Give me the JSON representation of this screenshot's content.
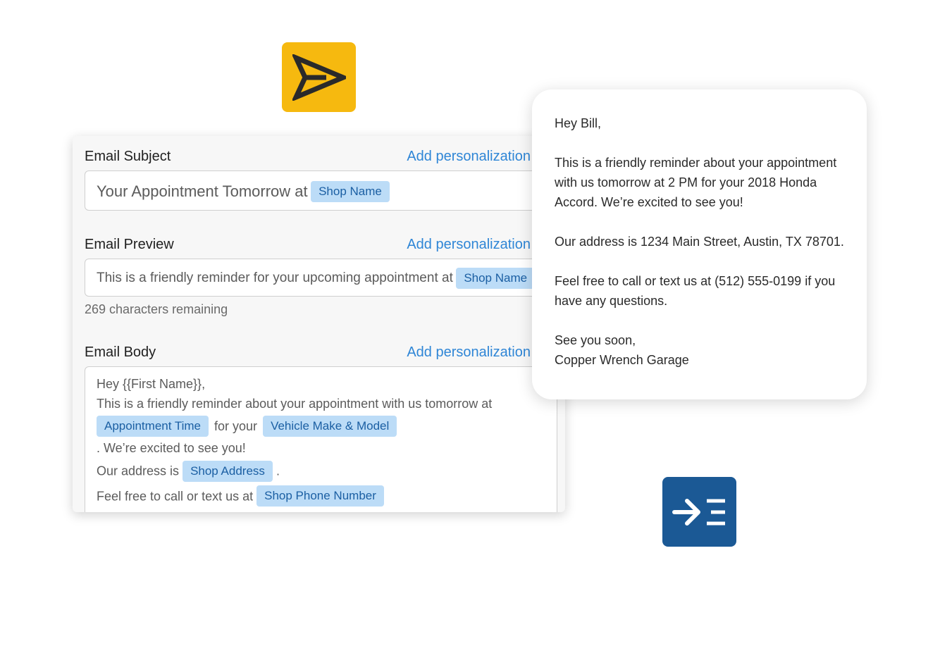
{
  "icons": {
    "send": "send-arrow-icon",
    "indent": "indent-arrow-icon",
    "send_color": "#f6b90f",
    "indent_color": "#1b5995"
  },
  "editor": {
    "subject": {
      "label": "Email Subject",
      "add_link": "Add personalization",
      "text": "Your Appointment Tomorrow at",
      "chip": "Shop Name"
    },
    "preview": {
      "label": "Email Preview",
      "add_link": "Add personalization",
      "text": "This is a friendly reminder for your upcoming appointment at",
      "chip": "Shop Name",
      "remaining": "269 characters remaining"
    },
    "body": {
      "label": "Email Body",
      "add_link": "Add personalization",
      "line1": "Hey {{First Name}},",
      "line2": "This is a friendly reminder about your appointment with us tomorrow at",
      "chip_time": "Appointment Time",
      "text_for": "for your",
      "chip_vehicle": "Vehicle Make & Model",
      "line4": ". We’re excited to see you!",
      "text_address": "Our address is",
      "chip_address": "Shop Address",
      "text_period": ".",
      "text_call": "Feel free to call or text us at",
      "chip_phone": "Shop Phone Number"
    }
  },
  "preview_card": {
    "greeting": "Hey Bill,",
    "para1": "This is a friendly reminder about your appointment with us tomorrow at 2 PM for your 2018 Honda Accord. We’re excited to see you!",
    "para2": "Our address is 1234 Main Street, Austin, TX 78701.",
    "para3": "Feel free to call or text us at (512) 555-0199 if you have any questions.",
    "signoff": "See you soon,",
    "signature": "Copper Wrench Garage"
  }
}
